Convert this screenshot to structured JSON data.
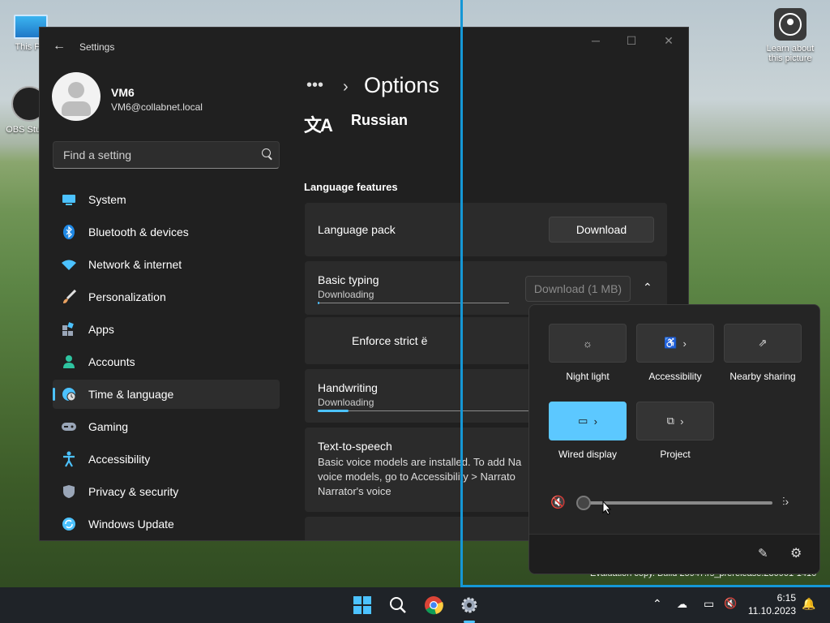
{
  "desktop": {
    "icons": [
      {
        "label": "This PC",
        "name": "this-pc"
      },
      {
        "label": "OBS Studio",
        "name": "obs-studio"
      },
      {
        "label": "Learn about this picture",
        "name": "learn-about-picture"
      }
    ],
    "watermark": "Evaluation copy. Build 25947.rs_prerelease.230901-1416"
  },
  "settings": {
    "window_title": "Settings",
    "user": {
      "name": "VM6",
      "email": "VM6@collabnet.local"
    },
    "search": {
      "placeholder": "Find a setting"
    },
    "nav": [
      {
        "label": "System",
        "icon": "monitor-icon",
        "color": "#4cc2ff"
      },
      {
        "label": "Bluetooth & devices",
        "icon": "bluetooth-icon",
        "color": "#1e88e5"
      },
      {
        "label": "Network & internet",
        "icon": "wifi-icon",
        "color": "#4cc2ff"
      },
      {
        "label": "Personalization",
        "icon": "brush-icon",
        "color": "#e8a060"
      },
      {
        "label": "Apps",
        "icon": "apps-icon",
        "color": "#9aa6b8"
      },
      {
        "label": "Accounts",
        "icon": "person-icon",
        "color": "#2ec4a0"
      },
      {
        "label": "Time & language",
        "icon": "globe-clock-icon",
        "color": "#4cc2ff"
      },
      {
        "label": "Gaming",
        "icon": "gamepad-icon",
        "color": "#9aa6b8"
      },
      {
        "label": "Accessibility",
        "icon": "accessibility-icon",
        "color": "#4cc2ff"
      },
      {
        "label": "Privacy & security",
        "icon": "shield-icon",
        "color": "#9aa6b8"
      },
      {
        "label": "Windows Update",
        "icon": "update-icon",
        "color": "#4cc2ff"
      }
    ],
    "active_nav": "Time & language",
    "breadcrumb_more": "•••",
    "page_title": "Options",
    "language_icon": "文A",
    "language_name": "Russian",
    "section_heading": "Language features",
    "language_pack": {
      "label": "Language pack",
      "button": "Download"
    },
    "basic_typing": {
      "label": "Basic typing",
      "status": "Downloading",
      "button": "Download (1 MB)",
      "progress": 0.0
    },
    "enforce": {
      "label": "Enforce strict ë"
    },
    "handwriting": {
      "label": "Handwriting",
      "status": "Downloading",
      "progress": 0.15
    },
    "tts": {
      "label": "Text-to-speech",
      "description": "Basic voice models are installed. To add Na voice models, go to Accessibility > Narrato Narrator's voice"
    }
  },
  "quick_settings": {
    "tiles": [
      {
        "label": "Night light",
        "icon": "brightness-icon",
        "on": false,
        "has_arrow": false
      },
      {
        "label": "Accessibility",
        "icon": "accessibility-icon",
        "on": false,
        "has_arrow": true
      },
      {
        "label": "Nearby sharing",
        "icon": "share-icon",
        "on": false,
        "has_arrow": false
      },
      {
        "label": "Wired display",
        "icon": "cast-icon",
        "on": true,
        "has_arrow": true
      },
      {
        "label": "Project",
        "icon": "project-icon",
        "on": false,
        "has_arrow": true
      }
    ],
    "volume": {
      "muted": true,
      "level": 0
    }
  },
  "taskbar": {
    "time": "6:15",
    "date": "11.10.2023"
  }
}
